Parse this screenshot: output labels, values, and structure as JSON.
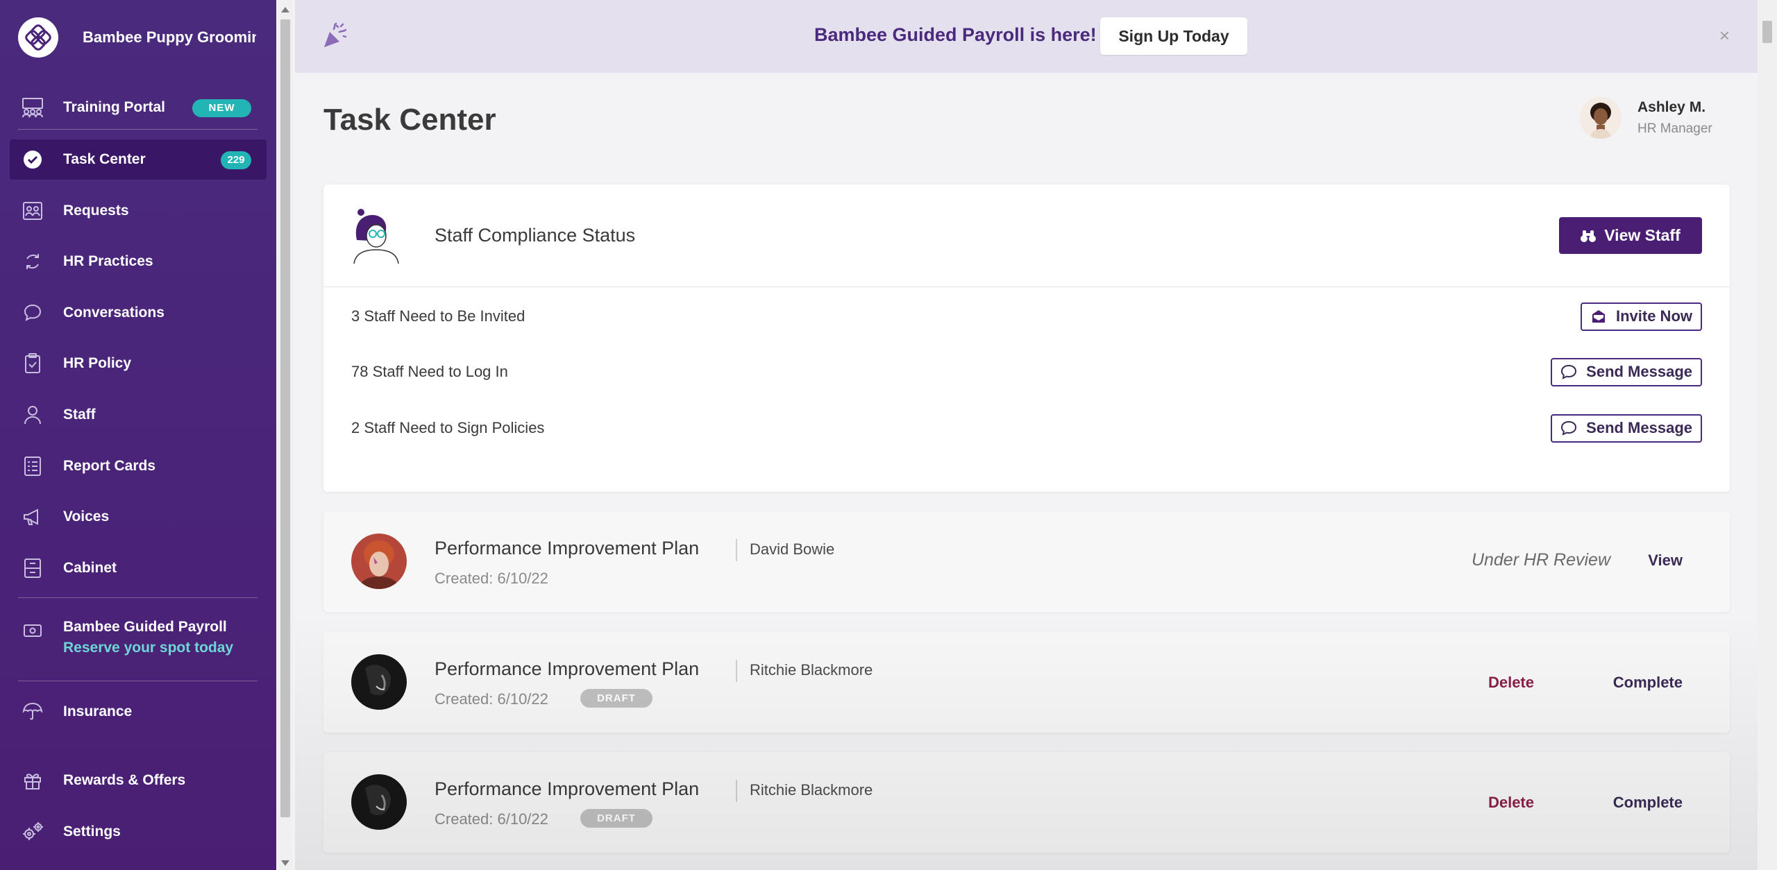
{
  "sidebar": {
    "brand_name": "Bambee Puppy Grooming",
    "items": [
      {
        "label": "Training Portal",
        "badge": "NEW",
        "icon": "people-board-icon"
      },
      {
        "label": "Task Center",
        "badge": "229",
        "icon": "check-circle-icon"
      },
      {
        "label": "Requests",
        "icon": "requests-icon"
      },
      {
        "label": "HR Practices",
        "icon": "cycle-icon"
      },
      {
        "label": "Conversations",
        "icon": "chat-bubble-icon"
      },
      {
        "label": "HR Policy",
        "icon": "clipboard-icon"
      },
      {
        "label": "Staff",
        "icon": "person-icon"
      },
      {
        "label": "Report Cards",
        "icon": "report-card-icon"
      },
      {
        "label": "Voices",
        "icon": "megaphone-icon"
      },
      {
        "label": "Cabinet",
        "icon": "cabinet-icon"
      }
    ],
    "promo": {
      "title": "Bambee Guided Payroll",
      "subtitle": "Reserve your spot today",
      "icon": "payroll-icon"
    },
    "insurance": {
      "label": "Insurance",
      "icon": "umbrella-icon"
    },
    "rewards": {
      "label": "Rewards & Offers",
      "icon": "gift-icon"
    },
    "settings": {
      "label": "Settings",
      "icon": "gears-icon"
    }
  },
  "banner": {
    "text": "Bambee Guided Payroll is here!",
    "button": "Sign Up Today",
    "close": "×",
    "icon": "party-popper-icon"
  },
  "header": {
    "title": "Task Center",
    "user_name": "Ashley M.",
    "user_role": "HR Manager"
  },
  "compliance": {
    "title": "Staff Compliance Status",
    "view_button": "View Staff",
    "rows": [
      {
        "text": "3 Staff Need to Be Invited",
        "action": "Invite Now",
        "icon": "envelope-icon"
      },
      {
        "text": "78 Staff Need to Log In",
        "action": "Send Message",
        "icon": "chat-bubble-icon"
      },
      {
        "text": "2 Staff Need to Sign Policies",
        "action": "Send Message",
        "icon": "chat-bubble-icon"
      }
    ]
  },
  "tasks": [
    {
      "title": "Performance Improvement Plan",
      "name": "David Bowie",
      "created": "Created: 6/10/22",
      "status": "Under HR Review",
      "action": "View"
    },
    {
      "title": "Performance Improvement Plan",
      "name": "Ritchie Blackmore",
      "created": "Created: 6/10/22",
      "badge": "DRAFT",
      "delete": "Delete",
      "complete": "Complete"
    },
    {
      "title": "Performance Improvement Plan",
      "name": "Ritchie Blackmore",
      "created": "Created: 6/10/22",
      "badge": "DRAFT",
      "delete": "Delete",
      "complete": "Complete"
    }
  ],
  "colors": {
    "sidebar": "#4a2479",
    "accent_teal": "#23b5b5",
    "primary_purple": "#4a1f73",
    "banner_bg": "#e5e0ed",
    "delete_red": "#8a2048"
  }
}
